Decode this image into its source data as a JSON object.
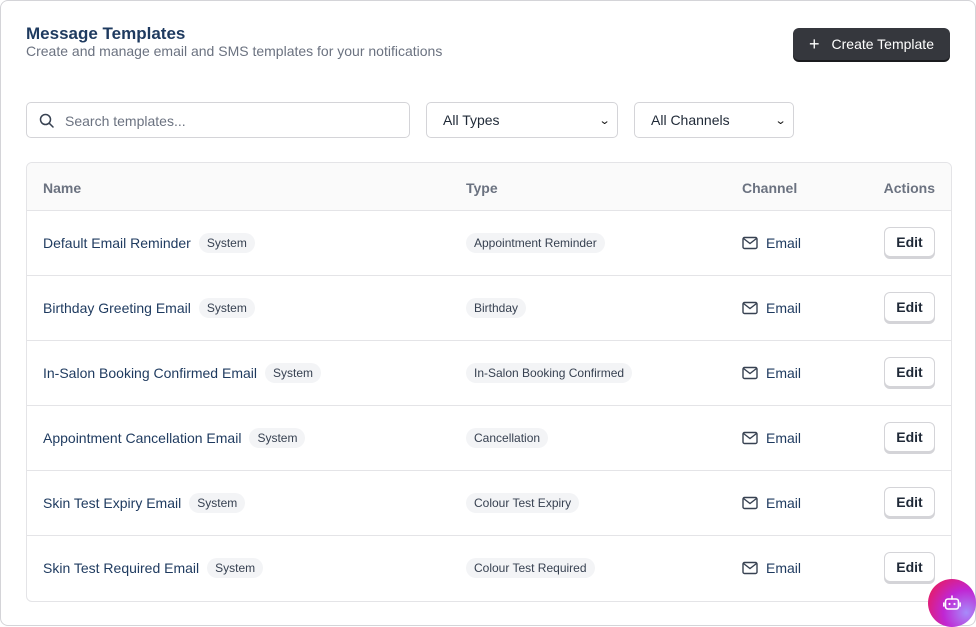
{
  "header": {
    "title": "Message Templates",
    "subtitle": "Create and manage email and SMS templates for your notifications",
    "create_label": "Create Template"
  },
  "filters": {
    "search_placeholder": "Search templates...",
    "type_selected": "All Types",
    "channel_selected": "All Channels"
  },
  "table": {
    "columns": {
      "name": "Name",
      "type": "Type",
      "channel": "Channel",
      "actions": "Actions"
    },
    "rows": [
      {
        "name": "Default Email Reminder",
        "badge": "System",
        "type": "Appointment Reminder",
        "channel": "Email",
        "action": "Edit"
      },
      {
        "name": "Birthday Greeting Email",
        "badge": "System",
        "type": "Birthday",
        "channel": "Email",
        "action": "Edit"
      },
      {
        "name": "In-Salon Booking Confirmed Email",
        "badge": "System",
        "type": "In-Salon Booking Confirmed",
        "channel": "Email",
        "action": "Edit"
      },
      {
        "name": "Appointment Cancellation Email",
        "badge": "System",
        "type": "Cancellation",
        "channel": "Email",
        "action": "Edit"
      },
      {
        "name": "Skin Test Expiry Email",
        "badge": "System",
        "type": "Colour Test Expiry",
        "channel": "Email",
        "action": "Edit"
      },
      {
        "name": "Skin Test Required Email",
        "badge": "System",
        "type": "Colour Test Required",
        "channel": "Email",
        "action": "Edit"
      }
    ]
  },
  "icons": {
    "search": "search-icon",
    "plus": "plus-icon",
    "chevron": "chevron-down-icon",
    "mail": "mail-icon",
    "assistant": "robot-icon"
  },
  "colors": {
    "primary_button": "#35373d",
    "link": "#1e3a5f",
    "assistant_gradient_start": "#e11d74",
    "assistant_gradient_end": "#a78bfa"
  }
}
